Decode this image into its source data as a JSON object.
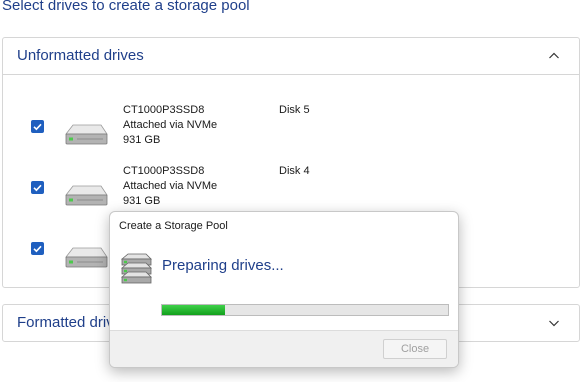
{
  "page": {
    "heading": "Select drives to create a storage pool"
  },
  "unformatted": {
    "title": "Unformatted drives",
    "expanded": true,
    "drives": [
      {
        "checked": true,
        "model": "CT1000P3SSD8",
        "connection": "Attached via NVMe",
        "size": "931 GB",
        "disk": "Disk 5"
      },
      {
        "checked": true,
        "model": "CT1000P3SSD8",
        "connection": "Attached via NVMe",
        "size": "931 GB",
        "disk": "Disk 4"
      },
      {
        "checked": true,
        "model": "",
        "connection": "",
        "size": "",
        "disk": ""
      }
    ]
  },
  "formatted": {
    "title": "Formatted drives",
    "expanded": false
  },
  "dialog": {
    "title": "Create a Storage Pool",
    "message": "Preparing drives...",
    "progress_percent": 22,
    "close_label": "Close",
    "close_enabled": false
  },
  "icons": {
    "section_expanded": "chevron-up-icon",
    "section_collapsed": "chevron-down-icon",
    "checkbox": "checkmark-icon",
    "drive": "hard-drive-icon",
    "dialog": "storage-pool-icon"
  },
  "colors": {
    "accent": "#1f5fbf",
    "heading_text": "#1f3f8a",
    "progress": "#12a01c"
  }
}
